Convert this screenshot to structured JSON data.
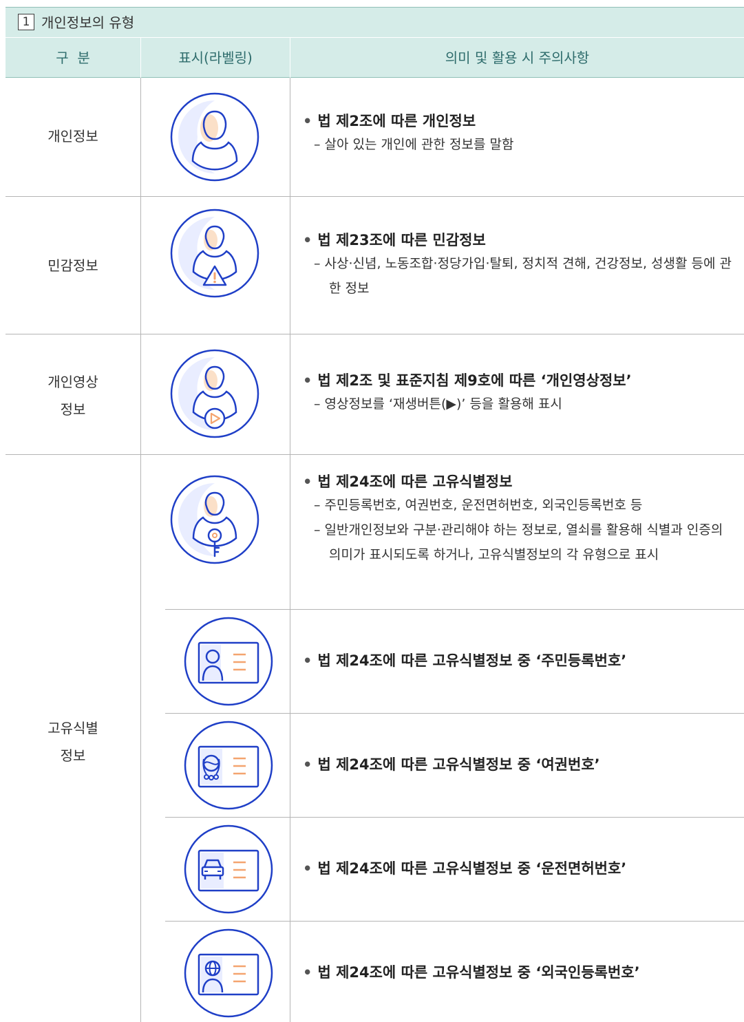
{
  "section": {
    "number": "1",
    "title": "개인정보의 유형"
  },
  "headers": {
    "category": "구  분",
    "label": "표시(라벨링)",
    "meaning": "의미 및 활용 시 주의사항"
  },
  "rows": [
    {
      "category": "개인정보",
      "icon": "person-icon",
      "heading": "법 제2조에 따른 개인정보",
      "subs": [
        "– 살아 있는 개인에 관한 정보를 말함"
      ]
    },
    {
      "category": "민감정보",
      "icon": "person-warning-icon",
      "heading": "법 제23조에 따른 민감정보",
      "subs": [
        "– 사상·신념, 노동조합·정당가입·탈퇴, 정치적 견해, 건강정보, 성생활 등에 관한 정보"
      ]
    },
    {
      "category_lines": [
        "개인영상",
        "정보"
      ],
      "icon": "person-play-icon",
      "heading": "법 제2조 및 표준지침 제9호에 따른 ‘개인영상정보’",
      "subs": [
        "– 영상정보를 ‘재생버튼(▶)’ 등을 활용해 표시"
      ]
    },
    {
      "category_lines": [
        "고유식별",
        "정보"
      ],
      "icon": "person-key-icon",
      "heading": "법 제24조에 따른 고유식별정보",
      "subs": [
        "– 주민등록번호, 여권번호, 운전면허번호, 외국인등록번호 등",
        "– 일반개인정보와 구분·관리해야 하는 정보로, 열쇠를 활용해 식별과 인증의 의미가 표시되도록 하거나, 고유식별정보의 각 유형으로 표시"
      ],
      "subrows": [
        {
          "icon": "resident-id-card-icon",
          "heading": "법 제24조에 따른 고유식별정보 중 ‘주민등록번호’"
        },
        {
          "icon": "passport-card-icon",
          "heading": "법 제24조에 따른 고유식별정보 중 ‘여권번호’"
        },
        {
          "icon": "driver-license-card-icon",
          "heading": "법 제24조에 따른 고유식별정보 중 ‘운전면허번호’"
        },
        {
          "icon": "foreigner-id-card-icon",
          "heading": "법 제24조에 따른 고유식별정보 중 ‘외국인등록번호’"
        }
      ]
    }
  ],
  "colors": {
    "header_bg": "#d5ece8",
    "header_text": "#2e6c6c",
    "icon_blue": "#1f3fc7",
    "icon_orange": "#f4a46f",
    "icon_fill": "#eef2ff"
  }
}
